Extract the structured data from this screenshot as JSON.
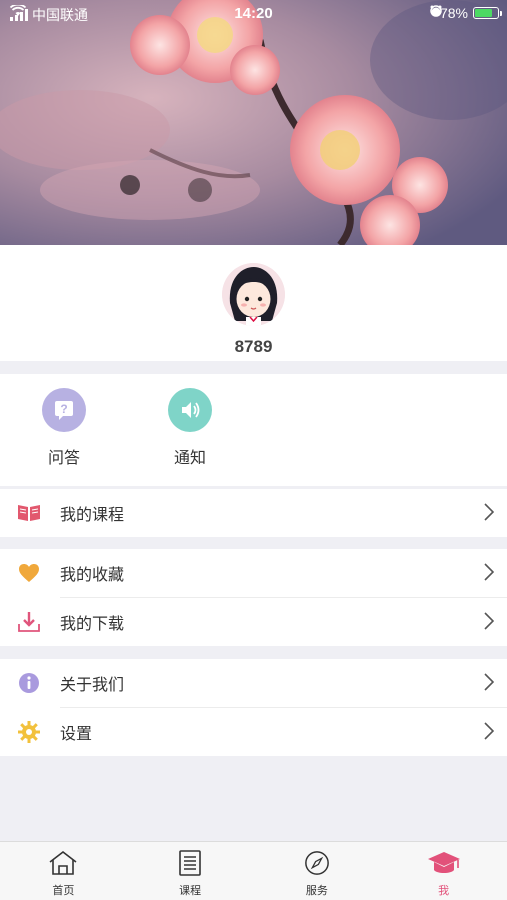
{
  "status_bar": {
    "carrier": "中国联通",
    "time": "14:20",
    "battery": "78%"
  },
  "profile": {
    "username": "8789"
  },
  "quick_actions": [
    {
      "label": "问答",
      "icon": "question-icon",
      "color": "#b7b1e2"
    },
    {
      "label": "通知",
      "icon": "speaker-icon",
      "color": "#7fd4c8"
    }
  ],
  "menu": {
    "courses": {
      "label": "我的课程",
      "icon": "book-icon"
    },
    "favorites": {
      "label": "我的收藏",
      "icon": "heart-icon"
    },
    "downloads": {
      "label": "我的下载",
      "icon": "download-icon"
    },
    "about": {
      "label": "关于我们",
      "icon": "info-icon"
    },
    "settings": {
      "label": "设置",
      "icon": "gear-icon"
    }
  },
  "tabbar": [
    {
      "label": "首页",
      "icon": "home-icon",
      "active": false
    },
    {
      "label": "课程",
      "icon": "list-icon",
      "active": false
    },
    {
      "label": "服务",
      "icon": "compass-icon",
      "active": false
    },
    {
      "label": "我",
      "icon": "graduation-cap-icon",
      "active": true
    }
  ],
  "colors": {
    "accent": "#e2517a",
    "background": "#efeff4"
  }
}
